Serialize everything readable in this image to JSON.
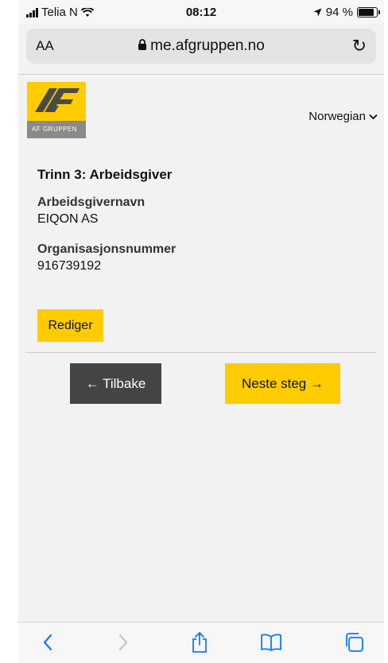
{
  "status_bar": {
    "carrier": "Telia N",
    "time": "08:12",
    "battery": "94 %",
    "battery_level": 0.94
  },
  "address_bar": {
    "text_size": "AA",
    "url": "me.afgruppen.no",
    "icons": [
      "lock-icon",
      "reload-icon"
    ]
  },
  "header": {
    "logo_mark": "AF",
    "logo_band": "AF GRUPPEN",
    "language": "Norwegian"
  },
  "form": {
    "step_title": "Trinn 3: Arbeidsgiver",
    "employer_label": "Arbeidsgivernavn",
    "employer_value": "EIQON AS",
    "org_label": "Organisasjonsnummer",
    "org_value": "916739192",
    "edit_label": "Rediger"
  },
  "nav": {
    "back_label": "← Tilbake",
    "next_label": "Neste steg →"
  },
  "toolbar": {
    "icons": [
      "back-icon",
      "forward-icon",
      "share-icon",
      "bookmarks-icon",
      "tabs-icon"
    ]
  },
  "colors": {
    "accent": "#ffcc00",
    "dark_button": "#444444",
    "safari_blue": "#0a7aff",
    "logo_band": "#8a8a8a"
  }
}
